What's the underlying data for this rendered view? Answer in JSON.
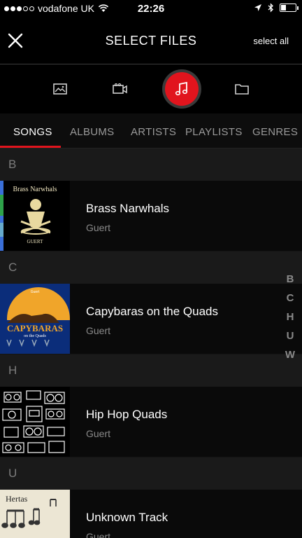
{
  "status_bar": {
    "carrier": "vodafone UK",
    "time": "22:26",
    "battery_level": 0.35
  },
  "header": {
    "title": "SELECT FILES",
    "select_all_label": "select all"
  },
  "media_types": [
    {
      "icon": "image-icon",
      "active": false
    },
    {
      "icon": "video-icon",
      "active": false
    },
    {
      "icon": "music-note-icon",
      "active": true
    },
    {
      "icon": "folder-icon",
      "active": false
    }
  ],
  "tabs": [
    {
      "label": "SONGS",
      "active": true
    },
    {
      "label": "ALBUMS",
      "active": false
    },
    {
      "label": "ARTISTS",
      "active": false
    },
    {
      "label": "PLAYLISTS",
      "active": false
    },
    {
      "label": "GENRES",
      "active": false
    }
  ],
  "sections": [
    {
      "letter": "B",
      "songs": [
        {
          "title": "Brass Narwhals",
          "artist": "Guert",
          "art_text": "Brass Narwhals",
          "art_sub": "GUERT"
        }
      ]
    },
    {
      "letter": "C",
      "songs": [
        {
          "title": "Capybaras on the Quads",
          "artist": "Guert",
          "art_text": "CAPYBARAS",
          "art_sub": "on the Quads",
          "art_top": "Guert"
        }
      ]
    },
    {
      "letter": "H",
      "songs": [
        {
          "title": "Hip Hop Quads",
          "artist": "Guert"
        }
      ]
    },
    {
      "letter": "U",
      "songs": [
        {
          "title": "Unknown Track",
          "artist": "Guert",
          "art_text": "Hertas"
        }
      ]
    }
  ],
  "alpha_index": [
    "B",
    "C",
    "H",
    "U",
    "W"
  ],
  "colors": {
    "accent": "#e1141d",
    "background": "#000000",
    "section_bg": "#1a1a1a"
  }
}
